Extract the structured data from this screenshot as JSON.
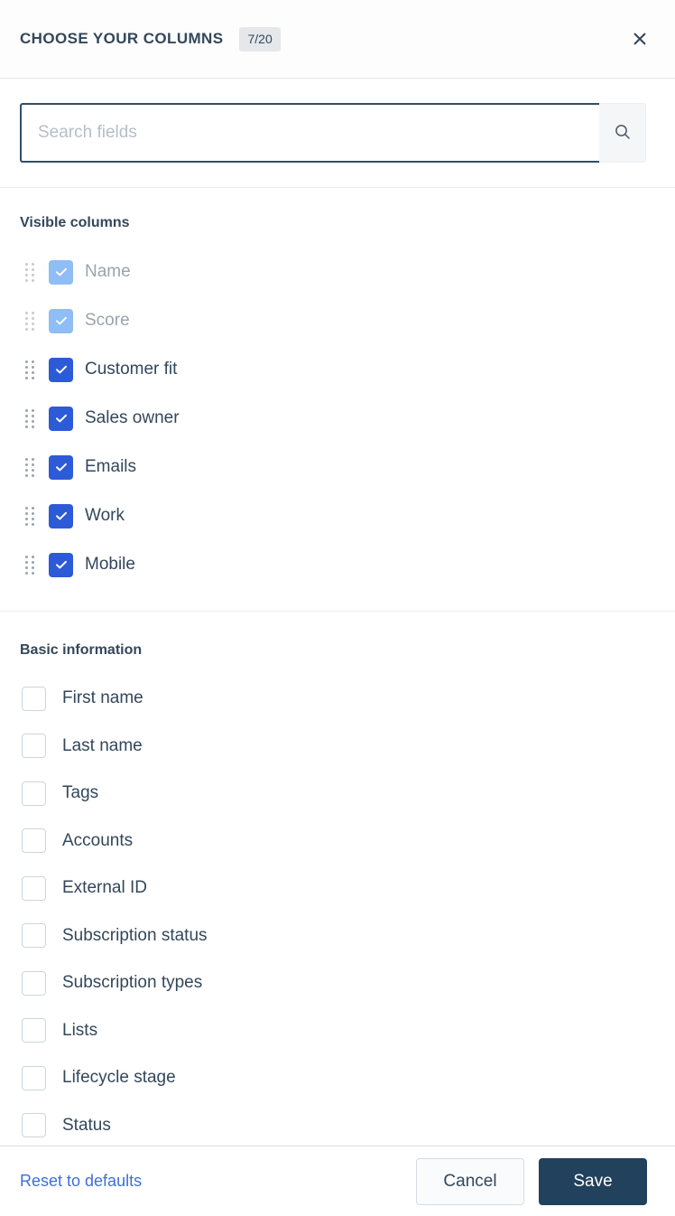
{
  "header": {
    "title": "CHOOSE YOUR COLUMNS",
    "count_badge": "7/20",
    "close_icon": "close-icon"
  },
  "search": {
    "placeholder": "Search fields",
    "value": "",
    "button_icon": "search-icon"
  },
  "visible_section": {
    "title": "Visible columns",
    "items": [
      {
        "label": "Name",
        "checked": true,
        "locked": true
      },
      {
        "label": "Score",
        "checked": true,
        "locked": true
      },
      {
        "label": "Customer fit",
        "checked": true,
        "locked": false
      },
      {
        "label": "Sales owner",
        "checked": true,
        "locked": false
      },
      {
        "label": "Emails",
        "checked": true,
        "locked": false
      },
      {
        "label": "Work",
        "checked": true,
        "locked": false
      },
      {
        "label": "Mobile",
        "checked": true,
        "locked": false
      }
    ]
  },
  "basic_section": {
    "title": "Basic information",
    "items": [
      {
        "label": "First name",
        "checked": false
      },
      {
        "label": "Last name",
        "checked": false
      },
      {
        "label": "Tags",
        "checked": false
      },
      {
        "label": "Accounts",
        "checked": false
      },
      {
        "label": "External ID",
        "checked": false
      },
      {
        "label": "Subscription status",
        "checked": false
      },
      {
        "label": "Subscription types",
        "checked": false
      },
      {
        "label": "Lists",
        "checked": false
      },
      {
        "label": "Lifecycle stage",
        "checked": false
      },
      {
        "label": "Status",
        "checked": false
      }
    ]
  },
  "footer": {
    "reset_label": "Reset to defaults",
    "cancel_label": "Cancel",
    "save_label": "Save"
  },
  "colors": {
    "checkbox_active": "#2d5bd7",
    "checkbox_locked": "#8fbdf5",
    "save_button": "#21415c",
    "link": "#3f6fd8",
    "input_border": "#2e4f68"
  }
}
